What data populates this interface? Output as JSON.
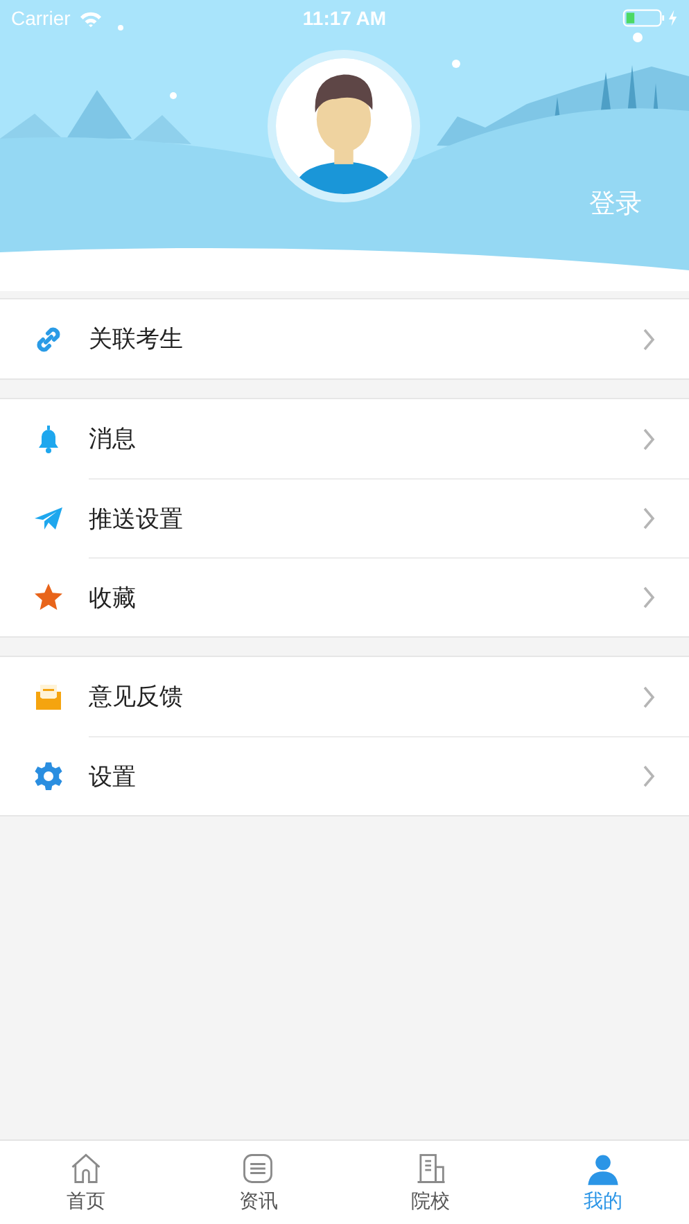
{
  "status_bar": {
    "carrier": "Carrier",
    "time": "11:17 AM"
  },
  "header": {
    "login": "登录"
  },
  "groups": [
    {
      "items": [
        {
          "label": "关联考生"
        }
      ]
    },
    {
      "items": [
        {
          "label": "消息"
        },
        {
          "label": "推送设置"
        },
        {
          "label": "收藏"
        }
      ]
    },
    {
      "items": [
        {
          "label": "意见反馈"
        },
        {
          "label": "设置"
        }
      ]
    }
  ],
  "tabs": [
    {
      "label": "首页",
      "selected": false
    },
    {
      "label": "资讯",
      "selected": false
    },
    {
      "label": "院校",
      "selected": false
    },
    {
      "label": "我的",
      "selected": true
    }
  ]
}
